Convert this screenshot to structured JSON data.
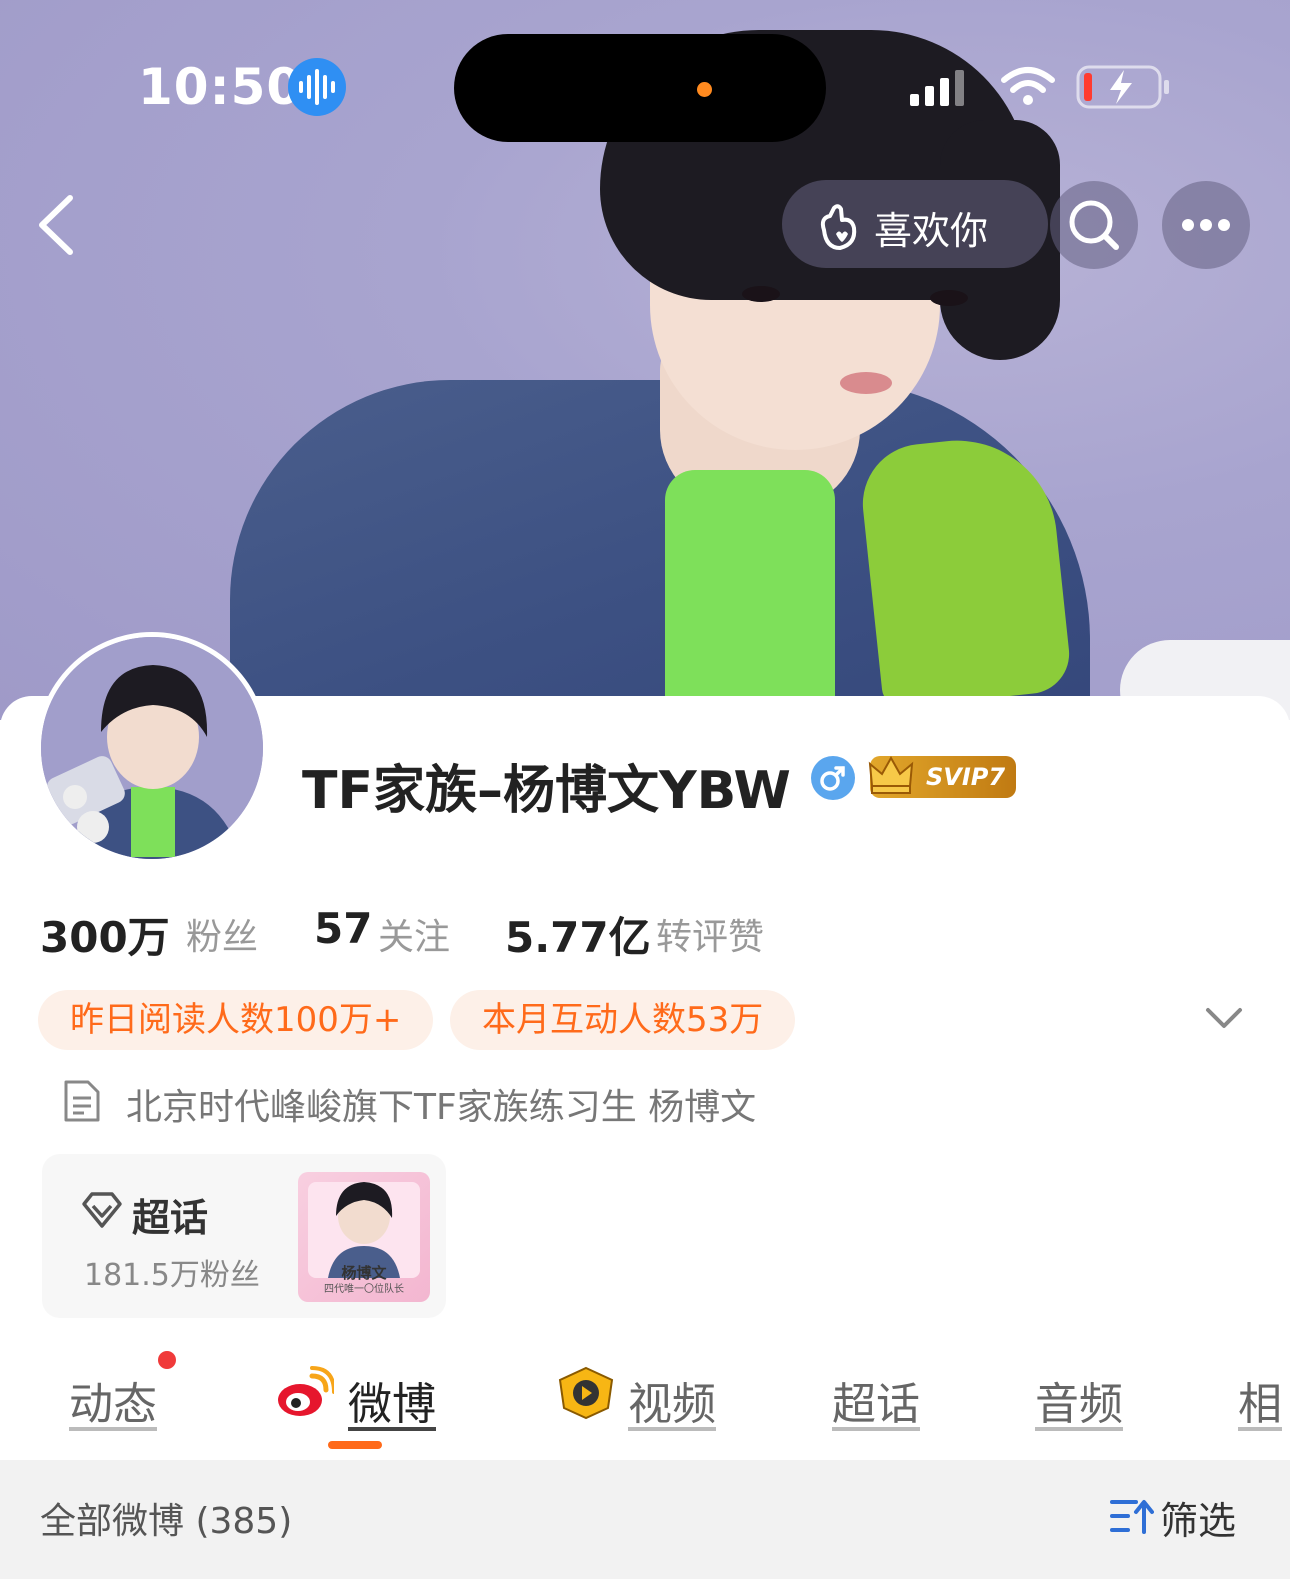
{
  "status_bar": {
    "time": "10:50"
  },
  "nav": {
    "like_label": "喜欢你"
  },
  "profile": {
    "name": "TF家族–杨博文YBW",
    "vip_badge": "SVIP7",
    "stats": [
      {
        "value": "300万",
        "label": "粉丝"
      },
      {
        "value": "57",
        "label": "关注"
      },
      {
        "value": "5.77亿",
        "label": "转评赞"
      }
    ],
    "badges": [
      "昨日阅读人数100万+",
      "本月互动人数53万"
    ],
    "bio": "北京时代峰峻旗下TF家族练习生  杨博文"
  },
  "supertopic": {
    "title": "超话",
    "fans": "181.5万粉丝",
    "thumb_caption": "杨博文",
    "thumb_subcaption": "四代唯一〇位队长"
  },
  "tabs": [
    "动态",
    "微博",
    "视频",
    "超话",
    "音频",
    "相"
  ],
  "filter": {
    "summary": "全部微博 (385)",
    "button": "筛选"
  },
  "colors": {
    "accent": "#ff6a1a",
    "badge_bg": "#fdf0e8",
    "verified_blue": "#5aa6ee",
    "vip_gold": "#e2a72b"
  }
}
